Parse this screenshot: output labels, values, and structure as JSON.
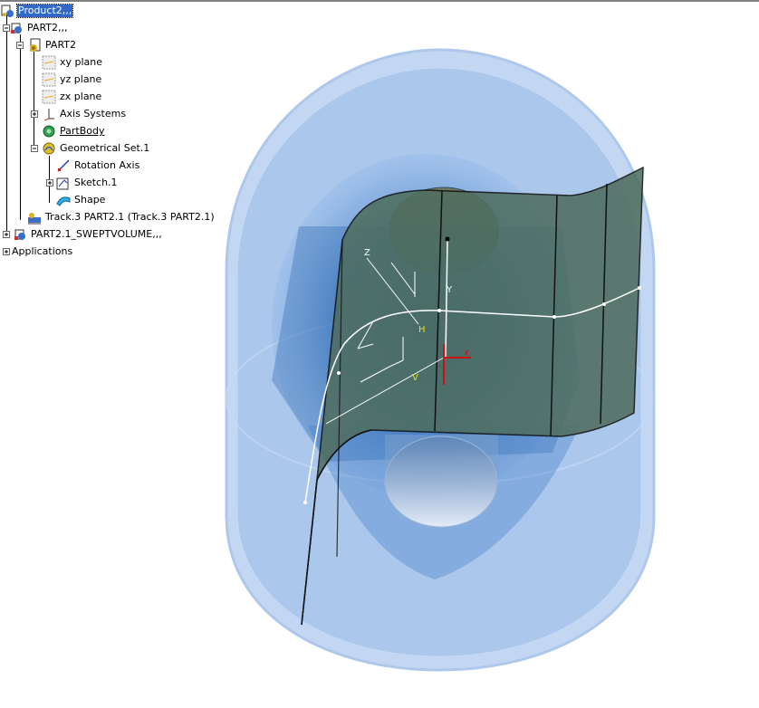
{
  "tree": {
    "nodes": [
      {
        "label": "Product2,,,",
        "icon": "product-icon",
        "selected": true
      },
      {
        "label": "PART2,,,",
        "icon": "part-instance-icon"
      },
      {
        "label": "PART2",
        "icon": "part-icon"
      },
      {
        "label": "xy plane",
        "icon": "plane-icon"
      },
      {
        "label": "yz plane",
        "icon": "plane-icon"
      },
      {
        "label": "zx plane",
        "icon": "plane-icon"
      },
      {
        "label": "Axis Systems",
        "icon": "axis-systems-icon"
      },
      {
        "label": "PartBody",
        "icon": "partbody-icon",
        "underline": true
      },
      {
        "label": "Geometrical Set.1",
        "icon": "geometrical-set-icon"
      },
      {
        "label": "Rotation Axis",
        "icon": "line-icon"
      },
      {
        "label": "Sketch.1",
        "icon": "sketch-icon"
      },
      {
        "label": "Shape",
        "icon": "shape-icon"
      },
      {
        "label": "Track.3 PART2.1 (Track.3 PART2.1)",
        "icon": "track-icon"
      },
      {
        "label": "PART2.1_SWEPTVOLUME,,,",
        "icon": "part-instance-icon"
      },
      {
        "label": "Applications",
        "icon": ""
      }
    ]
  },
  "axis_labels": {
    "h": "H",
    "v": "V",
    "z": "Z",
    "y": "Y",
    "x": "X"
  },
  "colors": {
    "selection": "#3169c6",
    "cylinder": "#a8c8f0",
    "surface": "#4e6b5e",
    "sweep": "#1e5aa8"
  }
}
